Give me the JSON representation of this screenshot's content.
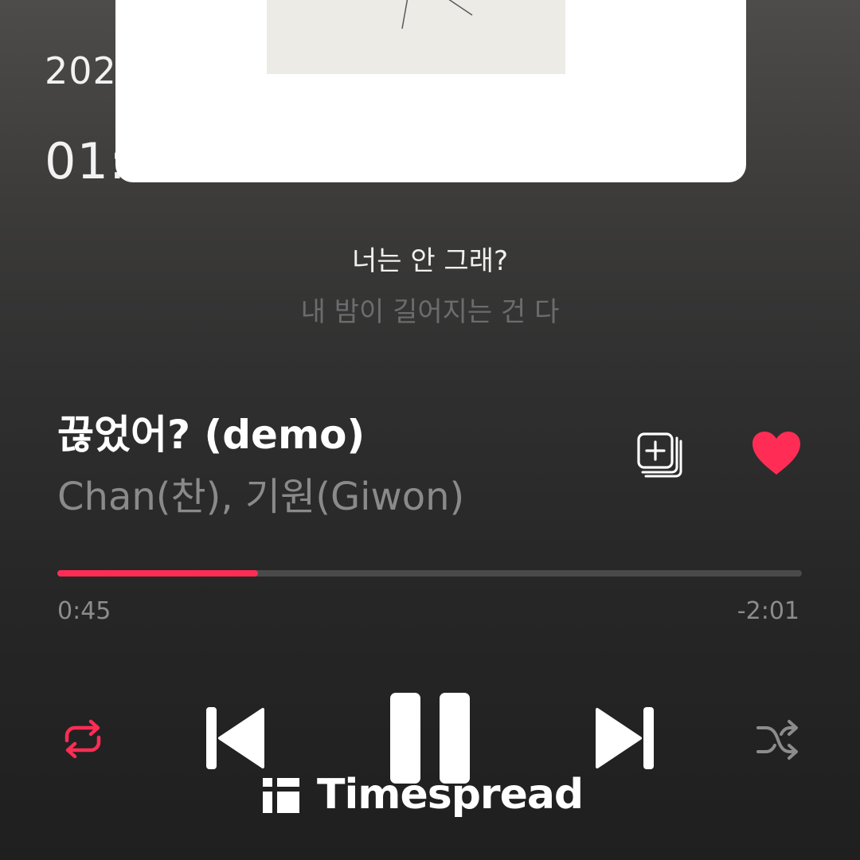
{
  "background": {
    "date_text": "202",
    "time_text": "01:"
  },
  "lyrics": {
    "current": "너는 안 그래?",
    "next": "내 밤이 길어지는 건 다"
  },
  "track": {
    "title": "끊었어? (demo)",
    "artist": "Chan(찬), 기원(Giwon)",
    "liked": true
  },
  "progress": {
    "elapsed": "0:45",
    "remaining": "-2:01",
    "fraction": 0.27
  },
  "controls": {
    "repeat_icon": "repeat-icon",
    "prev_icon": "skip-previous-icon",
    "play_state_icon": "pause-icon",
    "next_icon": "skip-next-icon",
    "shuffle_icon": "shuffle-icon",
    "add_icon": "add-to-playlist-icon",
    "like_icon": "heart-icon"
  },
  "watermark": {
    "text": "Timespread"
  },
  "colors": {
    "accent": "#ff2d55",
    "text_primary": "#ffffff",
    "text_secondary": "#8a8a8a",
    "track_bg": "#4a4a4a"
  }
}
